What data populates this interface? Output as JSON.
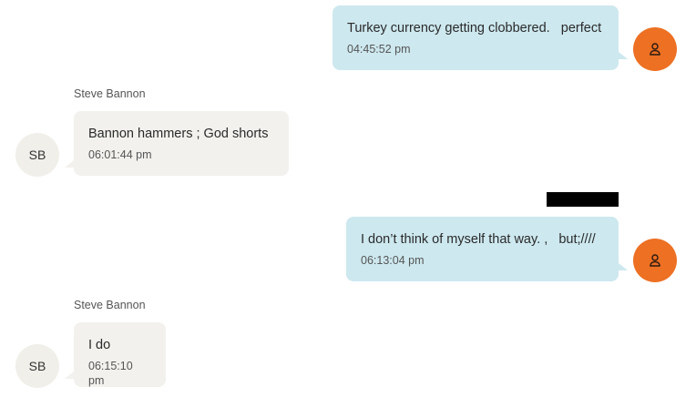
{
  "messages": [
    {
      "direction": "outgoing",
      "text": "Turkey currency getting clobbered.   perfect",
      "time": "04:45:52 pm",
      "avatar_icon": "person-icon"
    },
    {
      "direction": "incoming",
      "sender": "Steve Bannon",
      "initials": "SB",
      "text": "Bannon hammers ; God shorts",
      "time": "06:01:44 pm"
    },
    {
      "direction": "outgoing",
      "text": "I don’t think of myself that way. ,   but;////",
      "time": "06:13:04 pm",
      "avatar_icon": "person-icon",
      "redacted_label": true
    },
    {
      "direction": "incoming",
      "sender": "Steve Bannon",
      "initials": "SB",
      "text": "I do",
      "time": "06:15:10 pm"
    }
  ],
  "colors": {
    "outgoing_bubble": "#cde8ef",
    "incoming_bubble": "#f2f1ed",
    "me_avatar": "#ed7023",
    "sb_avatar": "#f0efe9",
    "redaction": "#000000"
  }
}
